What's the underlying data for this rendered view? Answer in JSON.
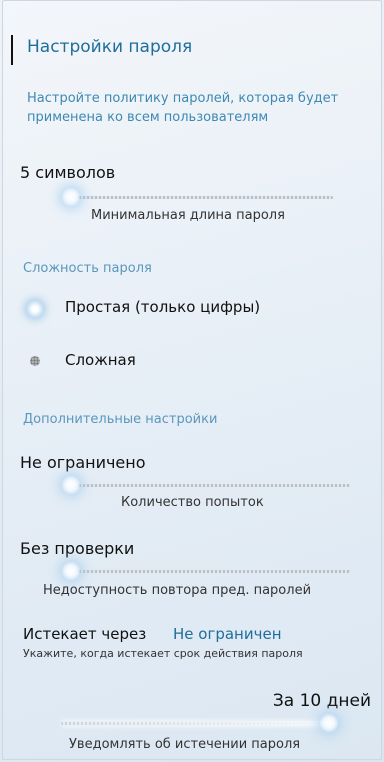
{
  "header": {
    "title": "Настройки пароля",
    "description": "Настройте политику паролей, которая будет применена ко всем пользователям"
  },
  "min_length": {
    "value": "5 символов",
    "caption": "Минимальная длина пароля",
    "level": 0
  },
  "complexity": {
    "section": "Сложность пароля",
    "options": [
      {
        "label": "Простая (только цифры)",
        "selected": true
      },
      {
        "label": "Сложная",
        "selected": false
      }
    ]
  },
  "additional": {
    "section": "Дополнительные настройки",
    "attempts": {
      "value": "Не ограничено",
      "caption": "Количество попыток",
      "level": 0
    },
    "history": {
      "value": "Без проверки",
      "caption": "Недоступность повтора пред. паролей",
      "level": 0
    },
    "expires": {
      "label": "Истекает через",
      "value": "Не ограничен",
      "hint": "Укажите, когда истекает срок действия пароля"
    },
    "notify": {
      "value": "За 10 дней",
      "caption": "Уведомлять об истечении пароля",
      "level": 1
    }
  },
  "colors": {
    "accent": "#1f6e9a",
    "section": "#5b97bd"
  }
}
